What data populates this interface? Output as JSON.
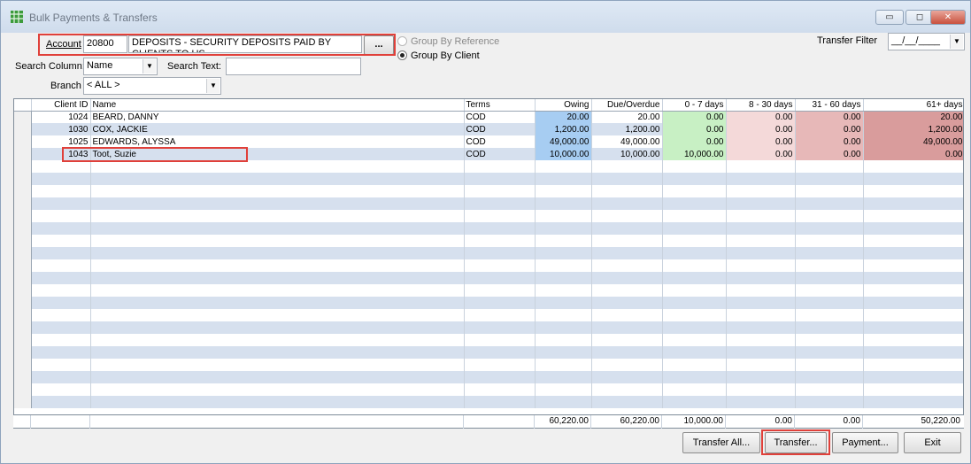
{
  "window": {
    "title": "Bulk Payments & Transfers",
    "controls": {
      "minimize": "▭",
      "maximize": "◻",
      "close": "✕"
    }
  },
  "form": {
    "account_label": "Account",
    "account_code": "20800",
    "account_description": "DEPOSITS - SECURITY DEPOSITS PAID BY CLIENTS TO US",
    "browse_label": "...",
    "group_by_reference": "Group By Reference",
    "group_by_client": "Group By Client",
    "transfer_filter_label": "Transfer Filter",
    "transfer_filter_value": "__/__/____",
    "search_column_label": "Search Column:",
    "search_column_value": "Name",
    "search_text_label": "Search Text:",
    "search_text_value": "",
    "branch_label": "Branch",
    "branch_value": "< ALL >"
  },
  "grid": {
    "columns": {
      "client_id": "Client ID",
      "name": "Name",
      "terms": "Terms",
      "owing": "Owing",
      "due": "Due/Overdue",
      "b07": "0 - 7 days",
      "b830": "8 - 30 days",
      "b3160": "31 - 60 days",
      "b61": "61+ days"
    },
    "rows": [
      {
        "client_id": "1024",
        "name": "BEARD, DANNY",
        "terms": "COD",
        "owing": "20.00",
        "due": "20.00",
        "b07": "0.00",
        "b830": "0.00",
        "b3160": "0.00",
        "b61": "20.00"
      },
      {
        "client_id": "1030",
        "name": "COX, JACKIE",
        "terms": "COD",
        "owing": "1,200.00",
        "due": "1,200.00",
        "b07": "0.00",
        "b830": "0.00",
        "b3160": "0.00",
        "b61": "1,200.00"
      },
      {
        "client_id": "1025",
        "name": "EDWARDS, ALYSSA",
        "terms": "COD",
        "owing": "49,000.00",
        "due": "49,000.00",
        "b07": "0.00",
        "b830": "0.00",
        "b3160": "0.00",
        "b61": "49,000.00"
      },
      {
        "client_id": "1043",
        "name": "Toot, Suzie",
        "terms": "COD",
        "owing": "10,000.00",
        "due": "10,000.00",
        "b07": "10,000.00",
        "b830": "0.00",
        "b3160": "0.00",
        "b61": "0.00"
      }
    ],
    "totals": {
      "owing": "60,220.00",
      "due": "60,220.00",
      "b07": "10,000.00",
      "b830": "0.00",
      "b3160": "0.00",
      "b61": "50,220.00"
    }
  },
  "buttons": {
    "transfer_all": "Transfer All...",
    "transfer": "Transfer...",
    "payment": "Payment...",
    "exit": "Exit"
  },
  "colors": {
    "highlight": "#e0403a",
    "owing": "#a7cdf2",
    "bucket_0_7": "#c8f0c4",
    "bucket_8_30": "#f4d9d9",
    "bucket_31_60": "#e7b8b8",
    "bucket_61_plus": "#d99c9c",
    "row_alt": "#d6e0ee"
  }
}
